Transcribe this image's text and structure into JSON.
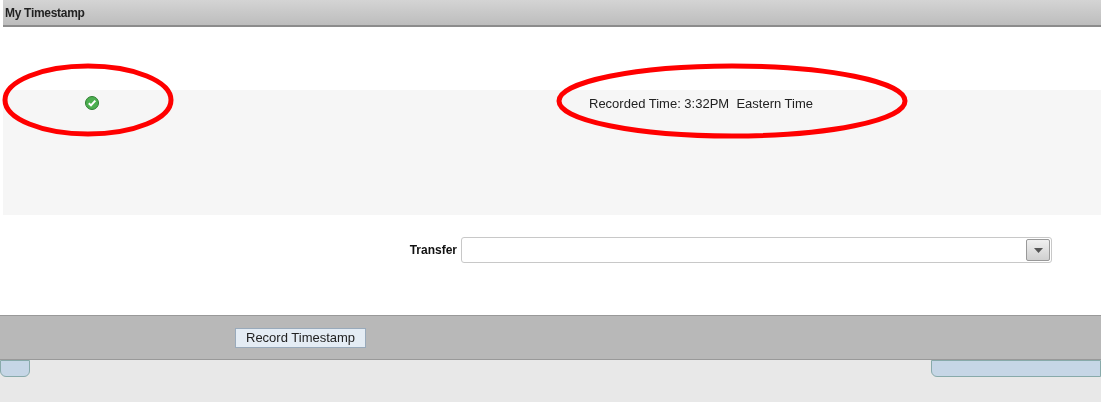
{
  "window": {
    "title": "My Timestamp"
  },
  "status": {
    "recorded": true,
    "text": "Recorded Time: 3:32PM  Eastern Time"
  },
  "transfer": {
    "label": "Transfer"
  },
  "buttons": [
    {
      "label": "Record Timestamp"
    }
  ]
}
